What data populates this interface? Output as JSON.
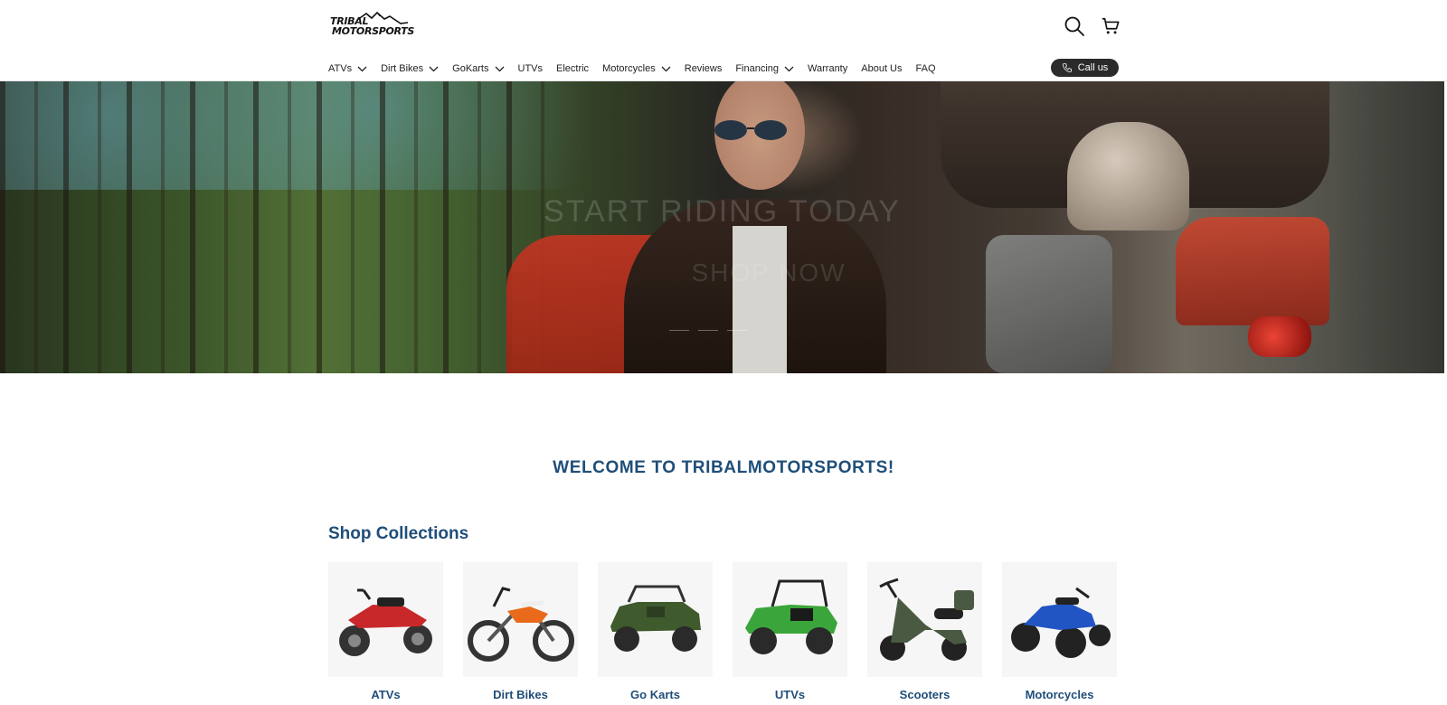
{
  "header": {
    "logo_line1": "TRIBAL",
    "logo_line2": "MOTORSPORTS",
    "search_icon": "search-icon",
    "cart_icon": "cart-icon"
  },
  "nav": {
    "items": [
      {
        "label": "ATVs",
        "dropdown": true
      },
      {
        "label": "Dirt Bikes",
        "dropdown": true
      },
      {
        "label": "GoKarts",
        "dropdown": true
      },
      {
        "label": "UTVs",
        "dropdown": false
      },
      {
        "label": "Electric",
        "dropdown": false
      },
      {
        "label": "Motorcycles",
        "dropdown": true
      },
      {
        "label": "Reviews",
        "dropdown": false
      },
      {
        "label": "Financing",
        "dropdown": true
      },
      {
        "label": "Warranty",
        "dropdown": false
      },
      {
        "label": "About Us",
        "dropdown": false
      },
      {
        "label": "FAQ",
        "dropdown": false
      }
    ],
    "call_label": "Call us",
    "call_icon": "phone-icon"
  },
  "hero": {
    "title": "START RIDING TODAY",
    "button": "SHOP NOW",
    "slides": 3,
    "active_slide": 1
  },
  "welcome": "WELCOME TO TRIBALMOTORSPORTS!",
  "shop_title": "Shop Collections",
  "collections": [
    {
      "label": "ATVs",
      "color": "#c8282a"
    },
    {
      "label": "Dirt Bikes",
      "color": "#e86a1a"
    },
    {
      "label": "Go Karts",
      "color": "#3f5a2c"
    },
    {
      "label": "UTVs",
      "color": "#3aa53a"
    },
    {
      "label": "Scooters",
      "color": "#4a5a42"
    },
    {
      "label": "Motorcycles",
      "color": "#2255c4"
    }
  ],
  "colors": {
    "accent": "#1f4e79",
    "call_bg": "#2b2b2b"
  }
}
